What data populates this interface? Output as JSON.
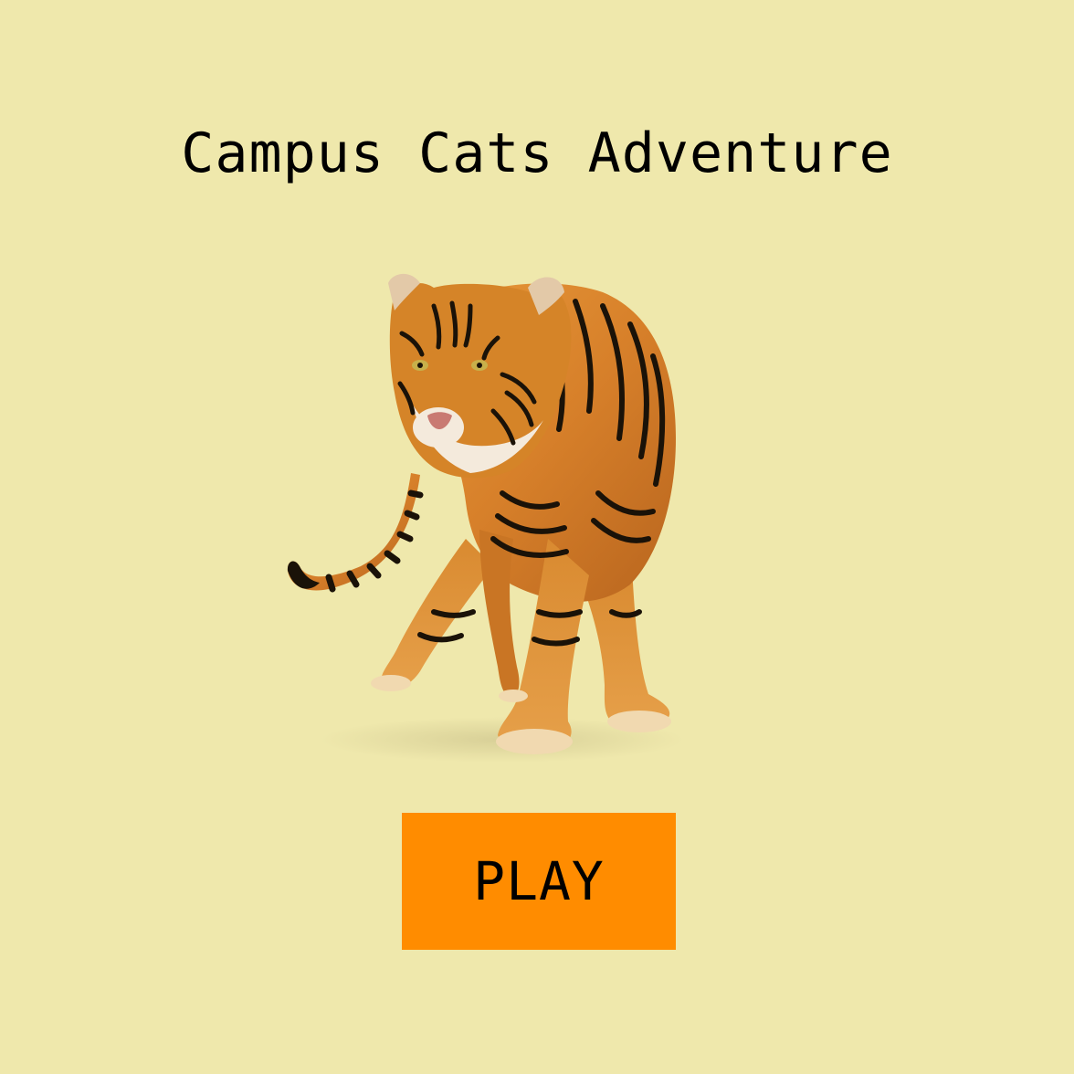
{
  "screen": {
    "title": "Campus Cats Adventure",
    "play_label": "PLAY",
    "hero_image": "walking-tiger-image"
  },
  "colors": {
    "background": "#EFE8AC",
    "play_button": "#FF8C00",
    "text": "#000000"
  }
}
